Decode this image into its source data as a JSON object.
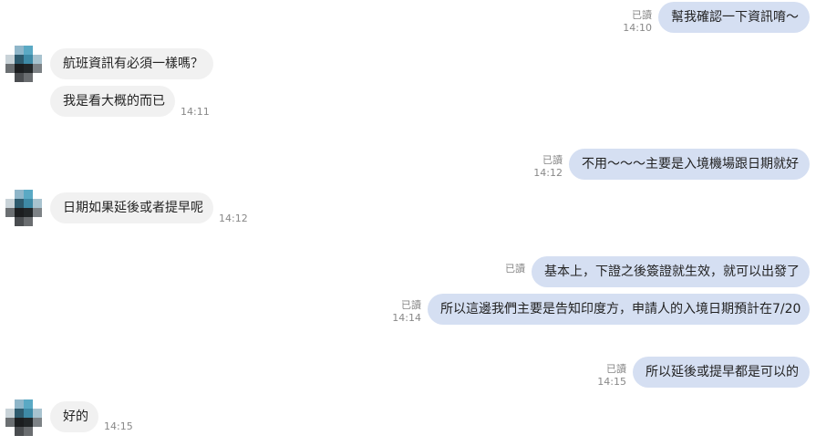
{
  "read_label": "已讀",
  "messages": [
    {
      "text": "幫我確認一下資訊唷～",
      "time": "14:10"
    },
    {
      "text": "航班資訊有必須一樣嗎？"
    },
    {
      "text": "我是看大概的而已",
      "time": "14:11"
    },
    {
      "text": "不用～～～主要是入境機場跟日期就好",
      "time": "14:12"
    },
    {
      "text": "日期如果延後或者提早呢",
      "time": "14:12"
    },
    {
      "text": "基本上，下證之後簽證就生效，就可以出發了"
    },
    {
      "text": "所以這邊我們主要是告知印度方，申請人的入境日期預計在7/20",
      "time": "14:14"
    },
    {
      "text": "所以延後或提早都是可以的",
      "time": "14:15"
    },
    {
      "text": "好的",
      "time": "14:15"
    }
  ]
}
